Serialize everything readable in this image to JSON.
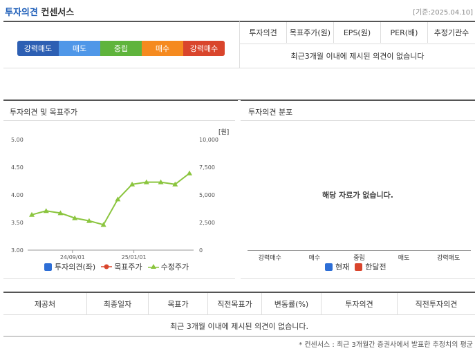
{
  "header": {
    "title_main": "투자의견",
    "title_sub": "컨센서스",
    "date_label": "[기준:2025.04.10]"
  },
  "consensus_bar": {
    "segments": [
      {
        "label": "강력매도",
        "color": "#2d5fb3"
      },
      {
        "label": "매도",
        "color": "#4f97e8"
      },
      {
        "label": "중립",
        "color": "#5fb43c"
      },
      {
        "label": "매수",
        "color": "#f58a1f"
      },
      {
        "label": "강력매수",
        "color": "#d9452c"
      }
    ]
  },
  "consensus_table": {
    "columns": [
      "투자의견",
      "목표주가(원)",
      "EPS(원)",
      "PER(배)",
      "추정기관수"
    ],
    "empty_message": "최근3개월 이내에 제시된 의견이 없습니다"
  },
  "opinion_chart_panel": {
    "title": "투자의견 및 목표주가",
    "unit": "[원]",
    "legend": [
      {
        "label": "투자의견(좌)",
        "color": "#2d6ed6"
      },
      {
        "label": "목표주가",
        "color": "#d9452c"
      },
      {
        "label": "수정주가",
        "color": "#8bc53f"
      }
    ]
  },
  "chart_data": {
    "type": "line",
    "x_tick_labels": [
      "24/09/01",
      "25/01/01"
    ],
    "y_left_ticks": [
      "5.00",
      "4.50",
      "4.00",
      "3.50",
      "3.00"
    ],
    "y_left_range": [
      3.0,
      5.0
    ],
    "y_right_ticks": [
      "10,000",
      "7,500",
      "5,000",
      "2,500",
      "0"
    ],
    "y_right_range": [
      0,
      10000
    ],
    "series": [
      {
        "name": "수정주가",
        "color": "#8bc53f",
        "axis": "right",
        "values": [
          3200,
          3550,
          3350,
          2900,
          2650,
          2300,
          4600,
          5950,
          6150,
          6150,
          5950,
          6950
        ]
      }
    ]
  },
  "distribution_panel": {
    "title": "투자의견 분포",
    "empty_message": "해당 자료가 없습니다.",
    "categories": [
      "강력매수",
      "매수",
      "중립",
      "매도",
      "강력매도"
    ],
    "legend": [
      {
        "label": "현재",
        "color": "#2d6ed6"
      },
      {
        "label": "한달전",
        "color": "#d9452c"
      }
    ]
  },
  "broker_table": {
    "columns": [
      "제공처",
      "최종일자",
      "목표가",
      "직전목표가",
      "변동률(%)",
      "투자의견",
      "직전투자의견"
    ],
    "empty_message": "최근 3개월 이내에 제시된 의견이 없습니다."
  },
  "footnote": "* 컨센서스 : 최근 3개월간 증권사에서 발표한 추정치의 평균"
}
